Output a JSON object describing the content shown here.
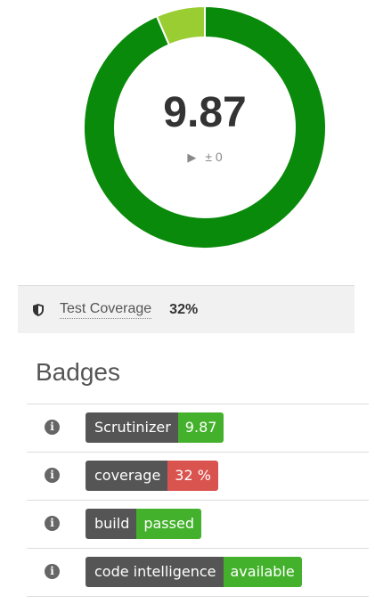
{
  "score": {
    "value": "9.87",
    "delta": "± 0",
    "ring": {
      "fraction": 0.935,
      "main_color": "#0a8a0a",
      "remainder_color": "#9acd32"
    }
  },
  "metrics": {
    "test_coverage": {
      "label": "Test Coverage",
      "value": "32%"
    }
  },
  "badges": {
    "heading": "Badges",
    "items": [
      {
        "left": "Scrutinizer",
        "right": "9.87",
        "color": "#44b12c"
      },
      {
        "left": "coverage",
        "right": "32 %",
        "color": "#d9534f"
      },
      {
        "left": "build",
        "right": "passed",
        "color": "#44b12c"
      },
      {
        "left": "code intelligence",
        "right": "available",
        "color": "#44b12c"
      }
    ]
  }
}
